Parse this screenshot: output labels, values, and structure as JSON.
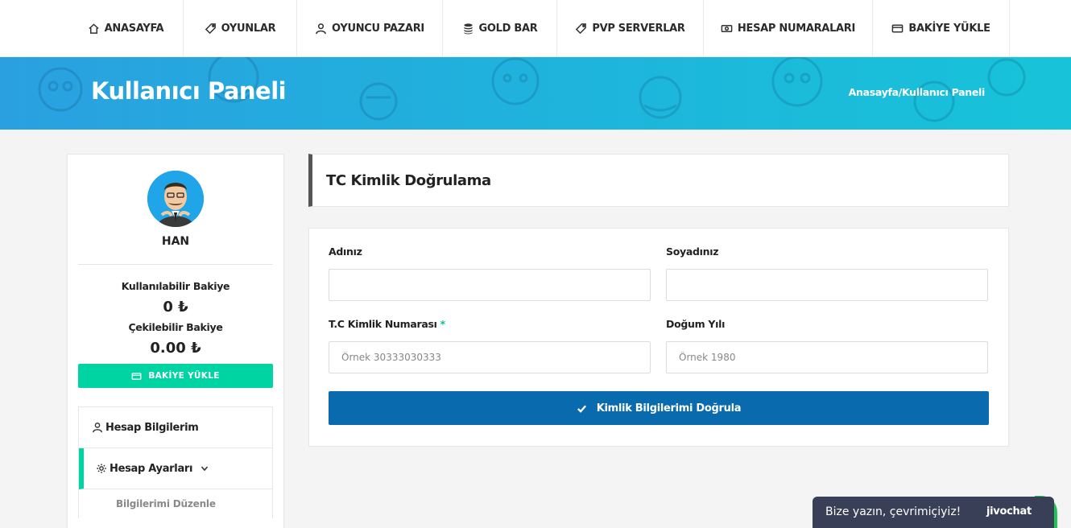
{
  "nav": {
    "items": [
      {
        "label": "ANASAYFA",
        "icon": "home-icon"
      },
      {
        "label": "OYUNLAR",
        "icon": "tag-icon"
      },
      {
        "label": "OYUNCU PAZARI",
        "icon": "user-icon"
      },
      {
        "label": "GOLD BAR",
        "icon": "coins-stack-icon"
      },
      {
        "label": "PVP SERVERLAR",
        "icon": "ticket-icon"
      },
      {
        "label": "HESAP NUMARALARI",
        "icon": "money-bill-icon"
      },
      {
        "label": "BAKİYE YÜKLE",
        "icon": "credit-card-icon"
      }
    ]
  },
  "banner": {
    "title": "Kullanıcı Paneli",
    "breadcrumb_home": "Anasayfa",
    "breadcrumb_sep": "/",
    "breadcrumb_current": "Kullanıcı Paneli"
  },
  "sidebar": {
    "username": "HAN",
    "usable_balance_label": "Kullanılabilir Bakiye",
    "usable_balance_value": "0 ₺",
    "withdrawable_balance_label": "Çekilebilir Bakiye",
    "withdrawable_balance_value": "0.00 ₺",
    "topup_label": "BAKİYE YÜKLE",
    "menu": [
      {
        "label": "Hesap Bilgilerim"
      },
      {
        "label": "Hesap Ayarları"
      }
    ],
    "submenu": [
      {
        "label": "Bilgilerimi Düzenle"
      }
    ]
  },
  "main": {
    "title": "TC Kimlik Doğrulama",
    "form": {
      "first_name_label": "Adınız",
      "first_name_value": "",
      "last_name_label": "Soyadınız",
      "last_name_value": "",
      "tc_label": "T.C Kimlik Numarası",
      "tc_required_mark": "*",
      "tc_placeholder": "Örnek 30333030333",
      "birth_year_label": "Doğum Yılı",
      "birth_year_placeholder": "Örnek 1980",
      "submit_label": "Kimlik Bilgilerimi Doğrula"
    }
  },
  "chat": {
    "text": "Bize yazın, çevrimiçiyiz!",
    "brand": "jivochat"
  },
  "colors": {
    "accent": "#00d4a3",
    "primary_button": "#0a6aae",
    "banner_start": "#2aa0e0",
    "banner_end": "#17c3d9",
    "chat_bg": "#3a3f58",
    "chat_green": "#1ec654"
  }
}
